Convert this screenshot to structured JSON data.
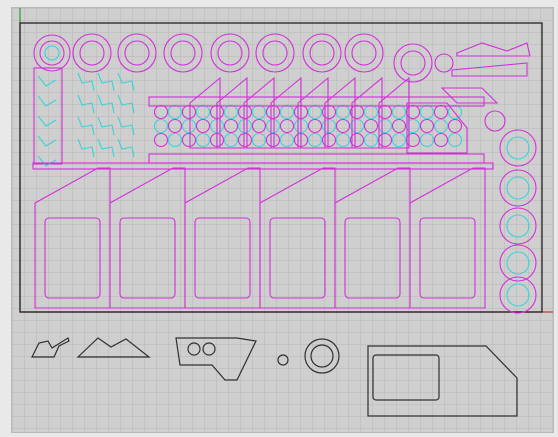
{
  "viewport": {
    "background": "#cfcfcf",
    "grid_color": "#b5b5b5",
    "grid_major_color": "#a3a3a3",
    "y_axis_color": "#2e9a2e",
    "x_axis_color": "#b04040",
    "sheet_border_color": "#222222",
    "magenta": "#d32fd9",
    "cyan": "#38d4d8",
    "dark_stroke": "#303030"
  }
}
